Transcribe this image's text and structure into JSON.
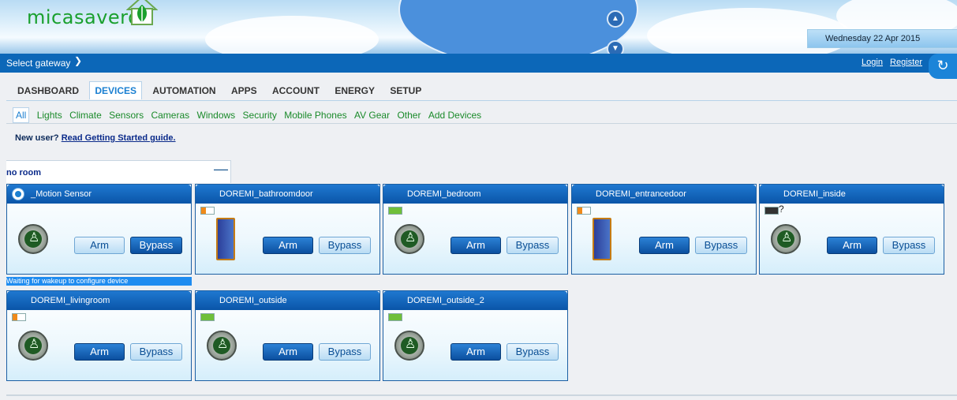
{
  "header": {
    "logo_text": "micasaverde",
    "date": "Wednesday 22 Apr 2015",
    "gateway_label": "Select gateway",
    "login": "Login",
    "register": "Register"
  },
  "tabs": [
    "DASHBOARD",
    "DEVICES",
    "AUTOMATION",
    "APPS",
    "ACCOUNT",
    "ENERGY",
    "SETUP"
  ],
  "subtabs": [
    "All",
    "Lights",
    "Climate",
    "Sensors",
    "Cameras",
    "Windows",
    "Security",
    "Mobile Phones",
    "AV Gear",
    "Other",
    "Add Devices"
  ],
  "new_user": {
    "prefix": "New user?",
    "link": "Read Getting Started guide."
  },
  "room": {
    "name": "no room",
    "collapse": "—"
  },
  "devices": [
    {
      "name": "_Motion Sensor",
      "arm": "Arm",
      "bypass": "Bypass",
      "status": "Waiting for wakeup to configure device",
      "icon": "motion-sensor",
      "battery": "none"
    },
    {
      "name": "DOREMI_bathroomdoor",
      "arm": "Arm",
      "bypass": "Bypass",
      "icon": "door-sensor",
      "battery": "low"
    },
    {
      "name": "DOREMI_bedroom",
      "arm": "Arm",
      "bypass": "Bypass",
      "icon": "motion-sensor",
      "battery": "full"
    },
    {
      "name": "DOREMI_entrancedoor",
      "arm": "Arm",
      "bypass": "Bypass",
      "icon": "door-sensor",
      "battery": "low"
    },
    {
      "name": "DOREMI_inside",
      "arm": "Arm",
      "bypass": "Bypass",
      "icon": "motion-sensor",
      "battery": "unknown",
      "battery_text": "?"
    },
    {
      "name": "DOREMI_livingroom",
      "arm": "Arm",
      "bypass": "Bypass",
      "icon": "motion-sensor",
      "battery": "low"
    },
    {
      "name": "DOREMI_outside",
      "arm": "Arm",
      "bypass": "Bypass",
      "icon": "motion-sensor",
      "battery": "full"
    },
    {
      "name": "DOREMI_outside_2",
      "arm": "Arm",
      "bypass": "Bypass",
      "icon": "motion-sensor",
      "battery": "full"
    }
  ],
  "colors": {
    "accent": "#0c67b8",
    "link_green": "#1a8a2a"
  }
}
